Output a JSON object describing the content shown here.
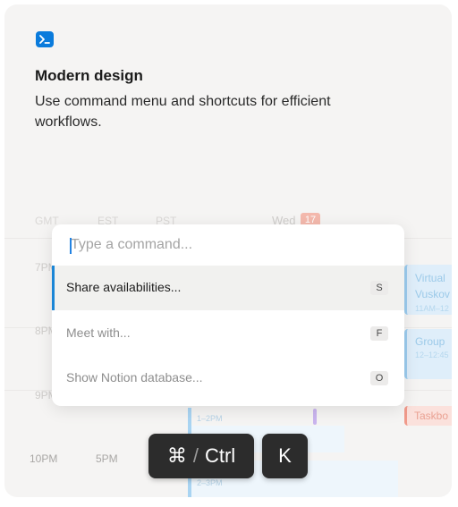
{
  "feature": {
    "icon": "terminal-icon",
    "title": "Modern design",
    "description": "Use command menu and shortcuts for efficient workflows."
  },
  "calendar": {
    "timezones": [
      "GMT",
      "EST",
      "PST"
    ],
    "day": "Wed",
    "date": "17",
    "times": {
      "t7pm": "7PM",
      "t8pm": "8PM",
      "t9pm": "9PM",
      "t10pm": "10PM",
      "t5pm": "5PM"
    },
    "events": {
      "virtual_title": "Virtual",
      "virtual_sub": "Vuskov",
      "virtual_time": "11AM–12",
      "group_title": "Group",
      "group_time": "12–12:45",
      "taskbo": "Taskbo",
      "slot_1_2": "1–2PM",
      "slot_2_3": "2–3PM"
    }
  },
  "command_menu": {
    "placeholder": "Type a command...",
    "items": [
      {
        "label": "Share availabilities...",
        "shortcut": "S",
        "active": true
      },
      {
        "label": "Meet with...",
        "shortcut": "F",
        "active": false
      },
      {
        "label": "Show Notion database...",
        "shortcut": "O",
        "active": false
      }
    ]
  },
  "shortcut_hint": {
    "modifier_symbol": "⌘",
    "separator": "/",
    "modifier_text": "Ctrl",
    "key": "K"
  },
  "colors": {
    "accent": "#1b86d6",
    "icon_bg": "#0a7bdc",
    "card_bg": "#f5f4f3"
  }
}
